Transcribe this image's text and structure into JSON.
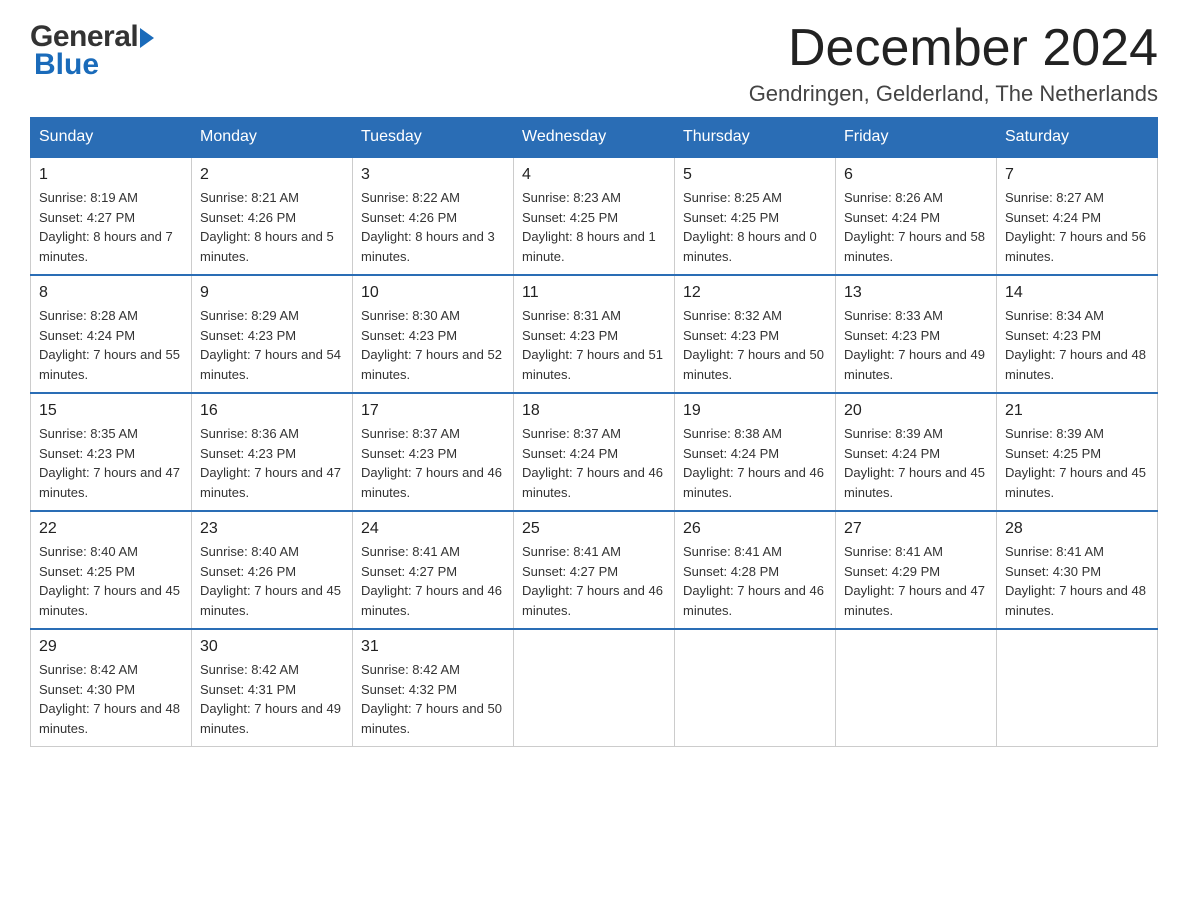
{
  "header": {
    "month_title": "December 2024",
    "subtitle": "Gendringen, Gelderland, The Netherlands",
    "logo_general": "General",
    "logo_blue": "Blue"
  },
  "days_of_week": [
    "Sunday",
    "Monday",
    "Tuesday",
    "Wednesday",
    "Thursday",
    "Friday",
    "Saturday"
  ],
  "weeks": [
    [
      {
        "day": "1",
        "sunrise": "8:19 AM",
        "sunset": "4:27 PM",
        "daylight": "8 hours and 7 minutes."
      },
      {
        "day": "2",
        "sunrise": "8:21 AM",
        "sunset": "4:26 PM",
        "daylight": "8 hours and 5 minutes."
      },
      {
        "day": "3",
        "sunrise": "8:22 AM",
        "sunset": "4:26 PM",
        "daylight": "8 hours and 3 minutes."
      },
      {
        "day": "4",
        "sunrise": "8:23 AM",
        "sunset": "4:25 PM",
        "daylight": "8 hours and 1 minute."
      },
      {
        "day": "5",
        "sunrise": "8:25 AM",
        "sunset": "4:25 PM",
        "daylight": "8 hours and 0 minutes."
      },
      {
        "day": "6",
        "sunrise": "8:26 AM",
        "sunset": "4:24 PM",
        "daylight": "7 hours and 58 minutes."
      },
      {
        "day": "7",
        "sunrise": "8:27 AM",
        "sunset": "4:24 PM",
        "daylight": "7 hours and 56 minutes."
      }
    ],
    [
      {
        "day": "8",
        "sunrise": "8:28 AM",
        "sunset": "4:24 PM",
        "daylight": "7 hours and 55 minutes."
      },
      {
        "day": "9",
        "sunrise": "8:29 AM",
        "sunset": "4:23 PM",
        "daylight": "7 hours and 54 minutes."
      },
      {
        "day": "10",
        "sunrise": "8:30 AM",
        "sunset": "4:23 PM",
        "daylight": "7 hours and 52 minutes."
      },
      {
        "day": "11",
        "sunrise": "8:31 AM",
        "sunset": "4:23 PM",
        "daylight": "7 hours and 51 minutes."
      },
      {
        "day": "12",
        "sunrise": "8:32 AM",
        "sunset": "4:23 PM",
        "daylight": "7 hours and 50 minutes."
      },
      {
        "day": "13",
        "sunrise": "8:33 AM",
        "sunset": "4:23 PM",
        "daylight": "7 hours and 49 minutes."
      },
      {
        "day": "14",
        "sunrise": "8:34 AM",
        "sunset": "4:23 PM",
        "daylight": "7 hours and 48 minutes."
      }
    ],
    [
      {
        "day": "15",
        "sunrise": "8:35 AM",
        "sunset": "4:23 PM",
        "daylight": "7 hours and 47 minutes."
      },
      {
        "day": "16",
        "sunrise": "8:36 AM",
        "sunset": "4:23 PM",
        "daylight": "7 hours and 47 minutes."
      },
      {
        "day": "17",
        "sunrise": "8:37 AM",
        "sunset": "4:23 PM",
        "daylight": "7 hours and 46 minutes."
      },
      {
        "day": "18",
        "sunrise": "8:37 AM",
        "sunset": "4:24 PM",
        "daylight": "7 hours and 46 minutes."
      },
      {
        "day": "19",
        "sunrise": "8:38 AM",
        "sunset": "4:24 PM",
        "daylight": "7 hours and 46 minutes."
      },
      {
        "day": "20",
        "sunrise": "8:39 AM",
        "sunset": "4:24 PM",
        "daylight": "7 hours and 45 minutes."
      },
      {
        "day": "21",
        "sunrise": "8:39 AM",
        "sunset": "4:25 PM",
        "daylight": "7 hours and 45 minutes."
      }
    ],
    [
      {
        "day": "22",
        "sunrise": "8:40 AM",
        "sunset": "4:25 PM",
        "daylight": "7 hours and 45 minutes."
      },
      {
        "day": "23",
        "sunrise": "8:40 AM",
        "sunset": "4:26 PM",
        "daylight": "7 hours and 45 minutes."
      },
      {
        "day": "24",
        "sunrise": "8:41 AM",
        "sunset": "4:27 PM",
        "daylight": "7 hours and 46 minutes."
      },
      {
        "day": "25",
        "sunrise": "8:41 AM",
        "sunset": "4:27 PM",
        "daylight": "7 hours and 46 minutes."
      },
      {
        "day": "26",
        "sunrise": "8:41 AM",
        "sunset": "4:28 PM",
        "daylight": "7 hours and 46 minutes."
      },
      {
        "day": "27",
        "sunrise": "8:41 AM",
        "sunset": "4:29 PM",
        "daylight": "7 hours and 47 minutes."
      },
      {
        "day": "28",
        "sunrise": "8:41 AM",
        "sunset": "4:30 PM",
        "daylight": "7 hours and 48 minutes."
      }
    ],
    [
      {
        "day": "29",
        "sunrise": "8:42 AM",
        "sunset": "4:30 PM",
        "daylight": "7 hours and 48 minutes."
      },
      {
        "day": "30",
        "sunrise": "8:42 AM",
        "sunset": "4:31 PM",
        "daylight": "7 hours and 49 minutes."
      },
      {
        "day": "31",
        "sunrise": "8:42 AM",
        "sunset": "4:32 PM",
        "daylight": "7 hours and 50 minutes."
      },
      null,
      null,
      null,
      null
    ]
  ]
}
